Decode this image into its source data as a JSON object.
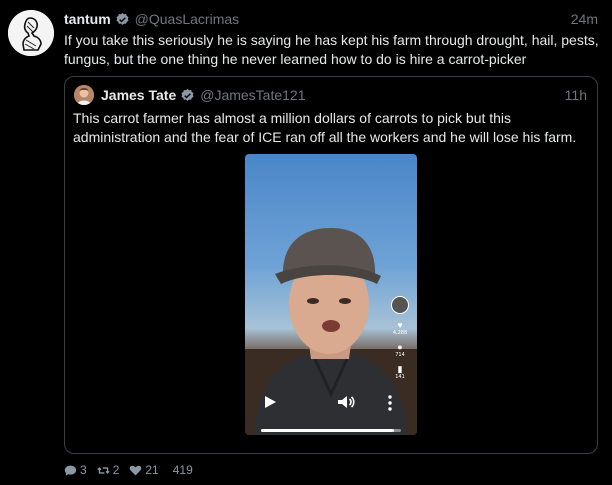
{
  "post": {
    "author_name": "tantum",
    "author_handle": "@QuasLacrimas",
    "time": "24m",
    "text": "If you take this seriously he is saying he has kept his farm through drought, hail, pests, fungus, but the one thing he never learned how to do is hire a carrot-picker",
    "avatar_icon": "bust-sketch-icon"
  },
  "quoted": {
    "author_name": "James Tate",
    "author_handle": "@JamesTate121",
    "time": "11h",
    "text": "This carrot farmer has almost a million dollars of carrots to pick but this administration and the fear of ICE ran off all the workers and he will lose his farm.",
    "video": {
      "progress_fraction": 0.95,
      "side_counts": [
        "4,288",
        "714",
        "141"
      ]
    }
  },
  "actions": {
    "replies": "3",
    "reposts": "2",
    "likes": "21",
    "views": "419"
  },
  "colors": {
    "background": "#000000",
    "text": "#e7e9ea",
    "muted": "#71767b",
    "verified": "#8b98a5",
    "border": "#3a3d41"
  }
}
